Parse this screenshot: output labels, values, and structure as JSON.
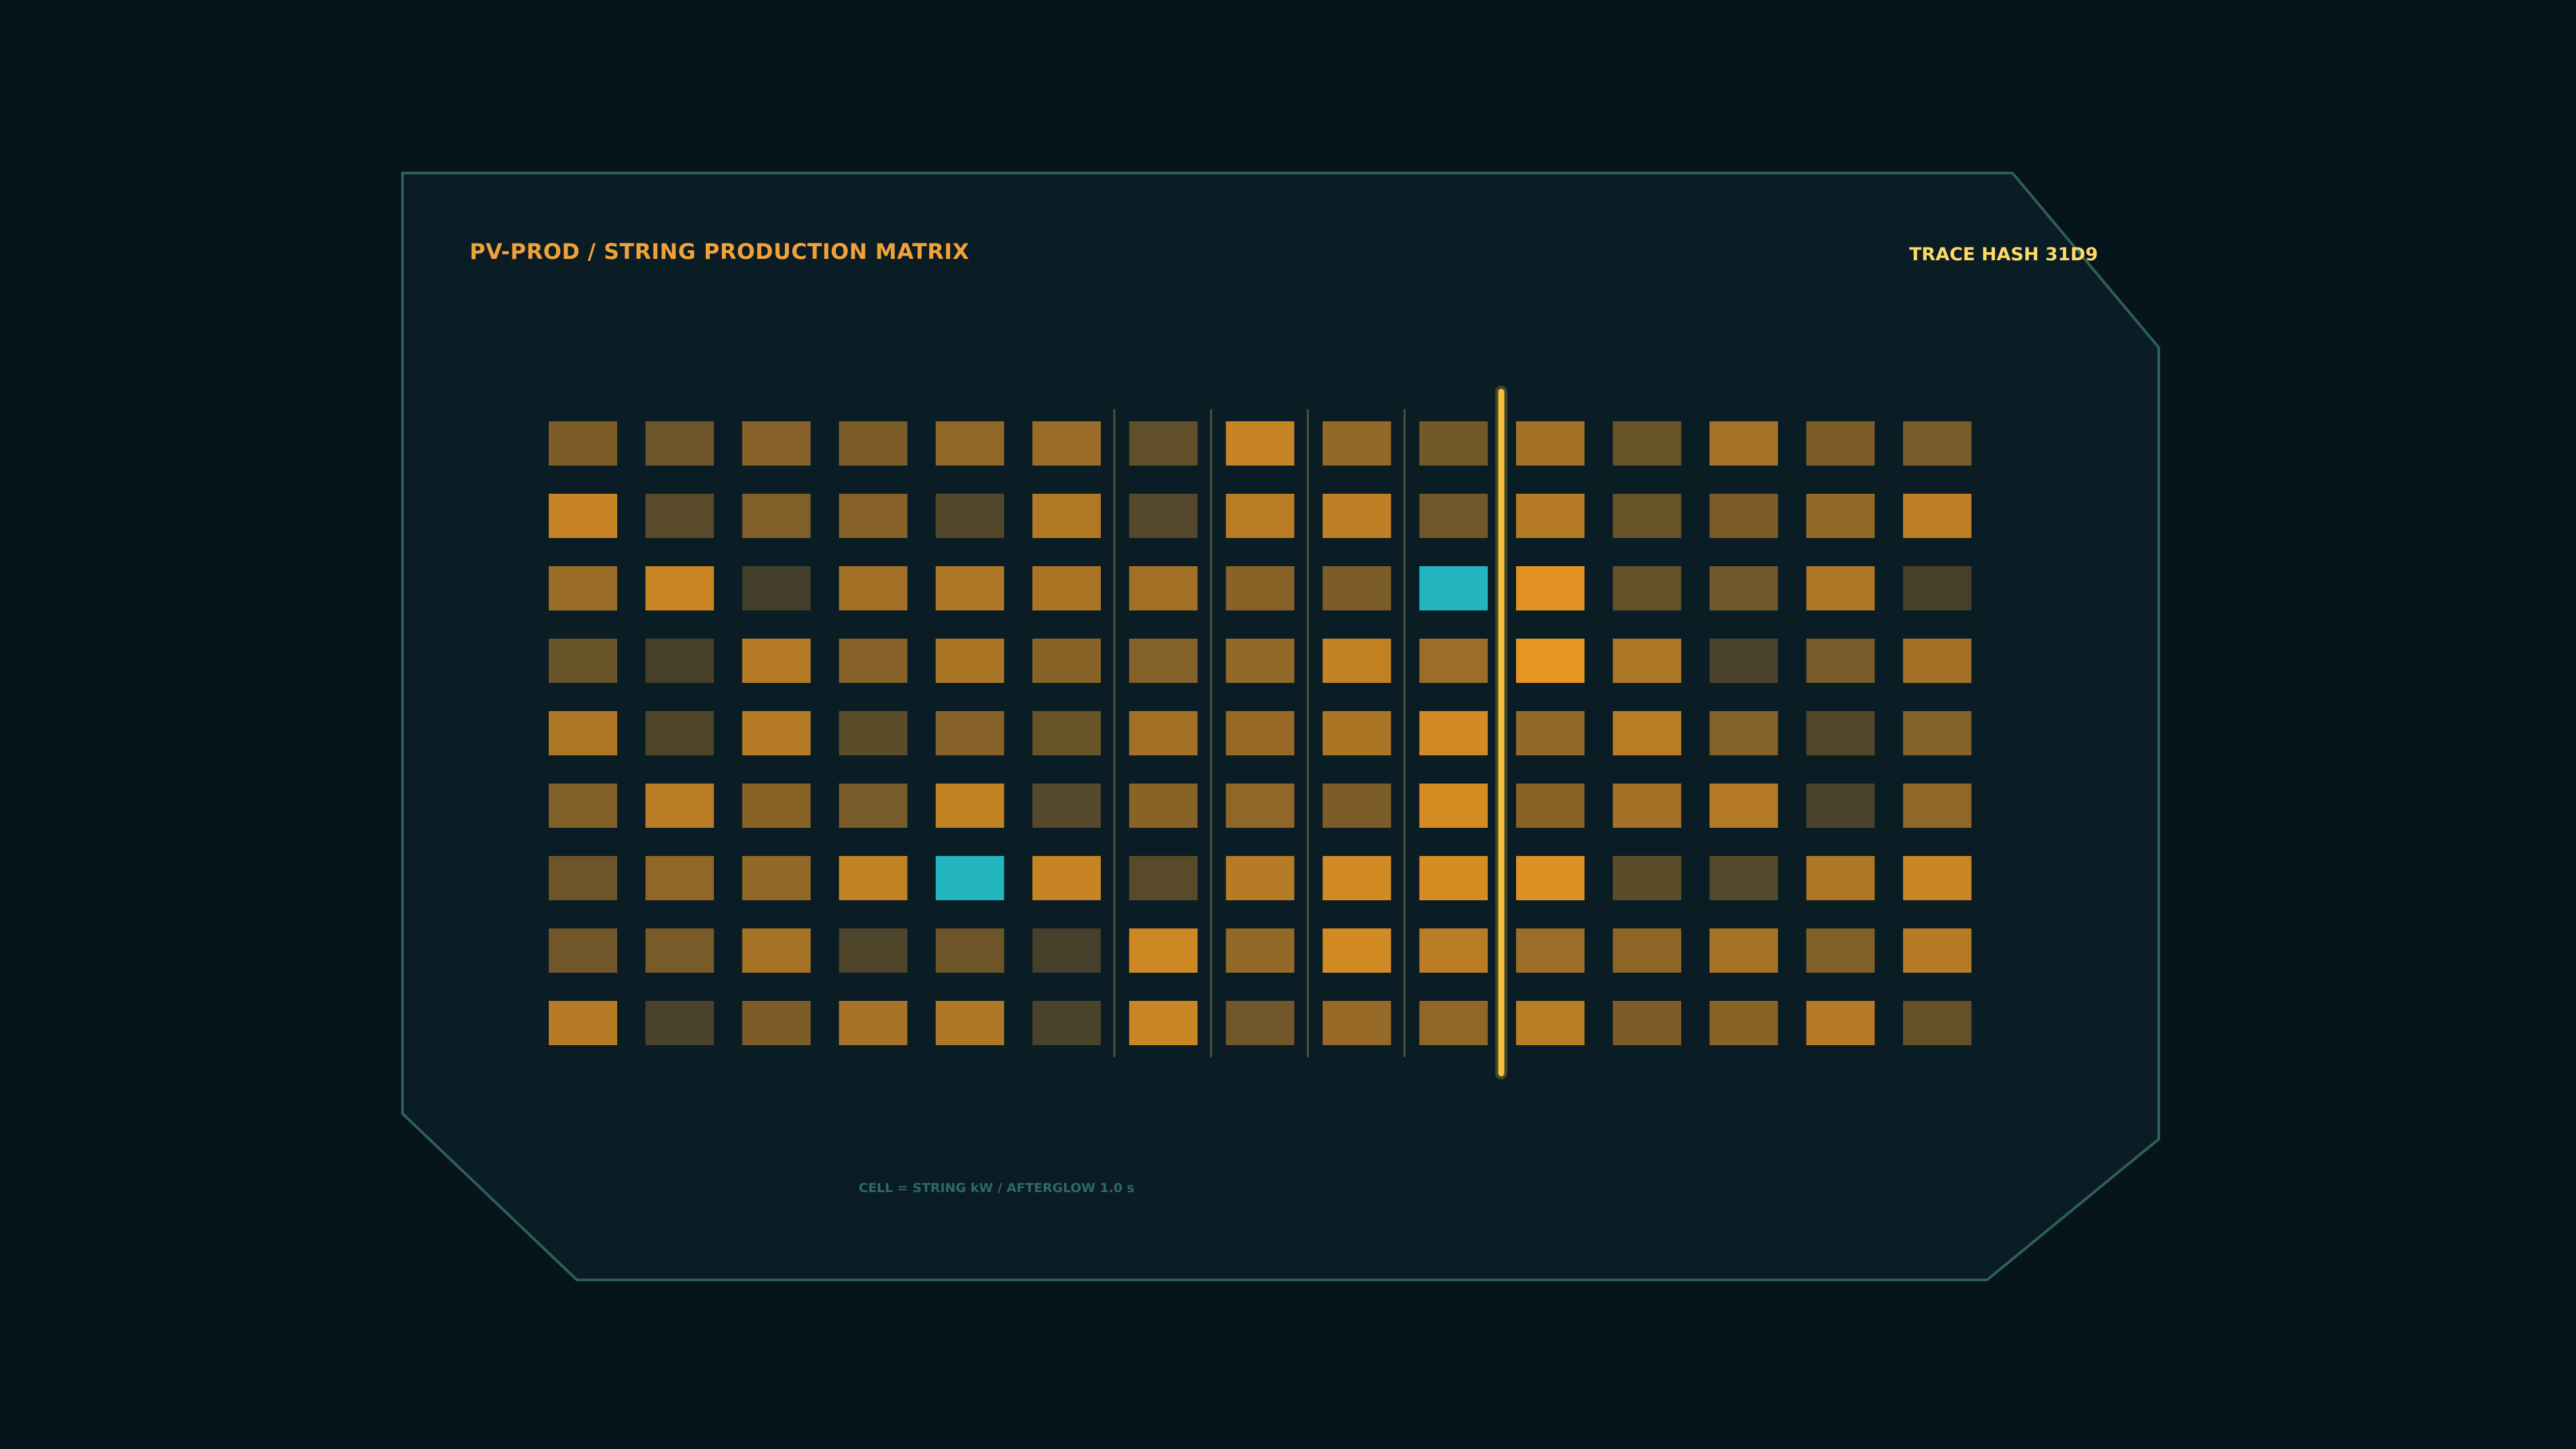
{
  "header": {
    "title": "PV-PROD / STRING PRODUCTION MATRIX",
    "trace_hash": "TRACE HASH 31D9"
  },
  "footer": {
    "legend": "CELL = STRING kW / AFTERGLOW 1.0 s"
  },
  "colors": {
    "background": "#06141b",
    "panel_fill": "#0a1c24",
    "panel_border": "#2f5e5a",
    "title": "#f0a23a",
    "hash": "#ffd966",
    "legend": "#2f6a63",
    "cell_low": "#2f342c",
    "cell_high": "#f09a22",
    "highlight": "#22b5c0",
    "trace_line": "#f2c23c",
    "column_marker": "#4a5236"
  },
  "matrix": {
    "columns": 15,
    "rows": 9,
    "levels": [
      [
        0.4,
        0.32,
        0.45,
        0.4,
        0.5,
        0.55,
        0.26,
        0.78,
        0.52,
        0.36,
        0.6,
        0.3,
        0.62,
        0.4,
        0.38
      ],
      [
        0.78,
        0.22,
        0.42,
        0.45,
        0.18,
        0.68,
        0.2,
        0.72,
        0.74,
        0.34,
        0.7,
        0.3,
        0.4,
        0.52,
        0.74
      ],
      [
        0.55,
        0.8,
        0.1,
        0.6,
        0.66,
        0.64,
        0.6,
        0.46,
        0.4,
        null,
        0.92,
        0.28,
        0.34,
        0.66,
        0.12
      ],
      [
        0.3,
        0.12,
        0.7,
        0.45,
        0.64,
        0.46,
        0.44,
        0.52,
        0.76,
        0.56,
        0.95,
        0.66,
        0.14,
        0.38,
        0.6
      ],
      [
        0.66,
        0.16,
        0.7,
        0.24,
        0.45,
        0.3,
        0.6,
        0.54,
        0.64,
        0.84,
        0.52,
        0.72,
        0.44,
        0.18,
        0.44
      ],
      [
        0.42,
        0.72,
        0.46,
        0.38,
        0.76,
        0.2,
        0.46,
        0.5,
        0.4,
        0.86,
        0.46,
        0.6,
        0.7,
        0.14,
        0.5
      ],
      [
        0.32,
        0.5,
        0.52,
        0.76,
        null,
        0.78,
        0.22,
        0.7,
        0.84,
        0.86,
        0.9,
        0.24,
        0.2,
        0.66,
        0.8
      ],
      [
        0.34,
        0.38,
        0.62,
        0.16,
        0.32,
        0.12,
        0.82,
        0.52,
        0.84,
        0.72,
        0.56,
        0.48,
        0.62,
        0.42,
        0.7
      ],
      [
        0.7,
        0.14,
        0.4,
        0.62,
        0.66,
        0.14,
        0.8,
        0.34,
        0.54,
        0.5,
        0.72,
        0.4,
        0.46,
        0.7,
        0.28
      ]
    ],
    "highlighted_cells": [
      [
        2,
        9
      ],
      [
        6,
        4
      ]
    ],
    "afterglow_columns": [
      6,
      7,
      8,
      9
    ],
    "trace_column": 10
  }
}
